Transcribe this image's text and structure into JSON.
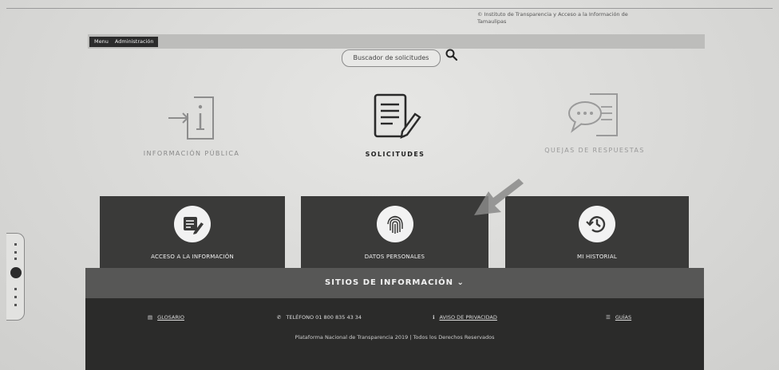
{
  "header": {
    "institute_text": "© Instituto de Transparencia y Acceso a la Información de Tamaulipas",
    "menu_items": [
      "Menu",
      "Administración"
    ],
    "search_label": "Buscador de solicitudes"
  },
  "categories": [
    {
      "label": "INFORMACIÓN PÚBLICA",
      "icon": "info-document-icon"
    },
    {
      "label": "SOLICITUDES",
      "icon": "document-pencil-icon"
    },
    {
      "label": "QUEJAS DE RESPUESTAS",
      "icon": "speech-bubble-document-icon"
    }
  ],
  "cards": [
    {
      "label": "ACCESO A LA INFORMACIÓN",
      "icon": "pencil-note-icon"
    },
    {
      "label": "DATOS PERSONALES",
      "icon": "fingerprint-icon"
    },
    {
      "label": "MI HISTORIAL",
      "icon": "history-clock-icon"
    }
  ],
  "sitios_label": "SITIOS DE INFORMACIÓN",
  "footer": {
    "glosario": "GLOSARIO",
    "telefono": "TELÉFONO 01 800 835 43 34",
    "aviso": "AVISO DE PRIVACIDAD",
    "guias": "GUÍAS",
    "copyright": "Plataforma Nacional de Transparencia 2019 | Todos los Derechos Reservados"
  },
  "colors": {
    "card_bg": "#3a3a39",
    "footer_bg": "#2b2b2a",
    "sitios_bg": "#575756",
    "pointer_arrow": "#8a8a88"
  }
}
